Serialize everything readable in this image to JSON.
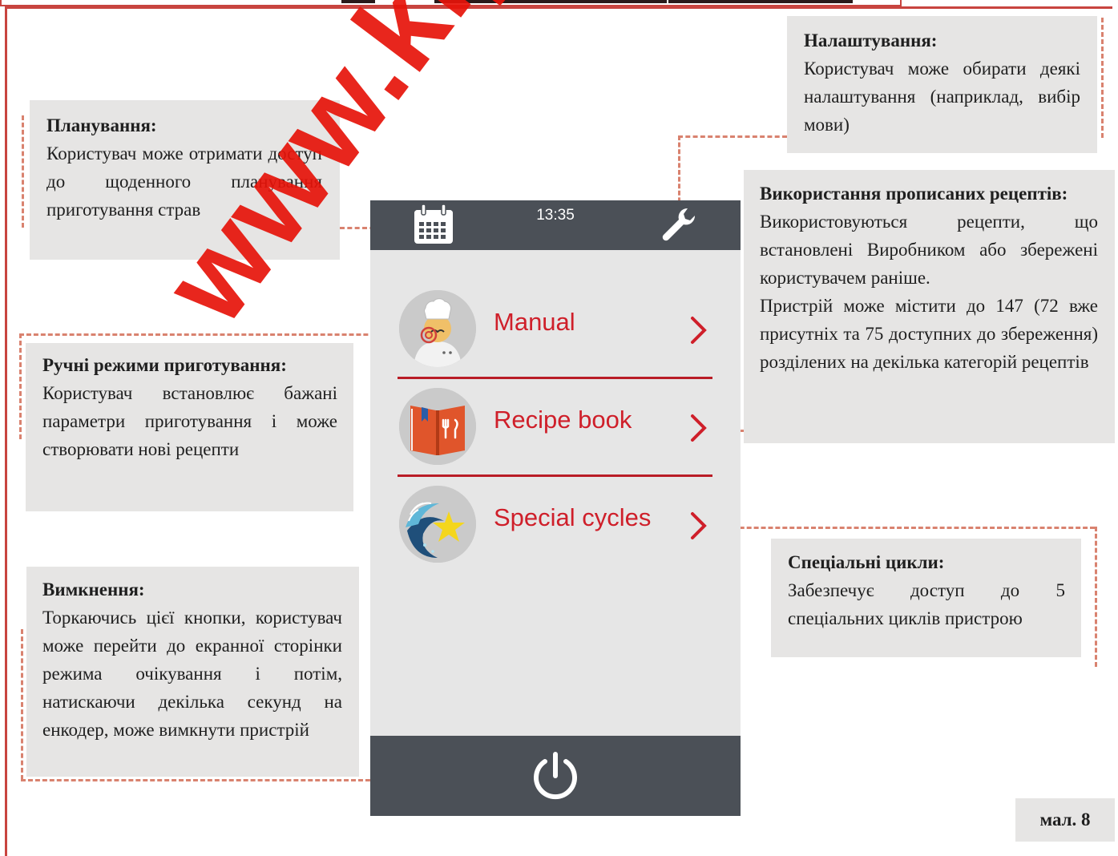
{
  "device": {
    "time": "13:35",
    "menu": [
      {
        "label": "Manual",
        "icon": "chef-icon"
      },
      {
        "label": "Recipe book",
        "icon": "recipe-book-icon"
      },
      {
        "label": "Special cycles",
        "icon": "special-cycles-icon"
      }
    ],
    "accent_color": "#cf1f2a",
    "bar_color": "#4b5057"
  },
  "notes": {
    "planning": {
      "title": "Планування:",
      "body": "Користувач може отримати доступ до щоденного планування приготування страв"
    },
    "settings": {
      "title": "Налаштування:",
      "body": "Користувач може обирати деякі налаштування (наприклад, вибір мови)"
    },
    "recipes": {
      "title": "Використання прописаних рецептів:",
      "body": "Використовуються рецепти, що встановлені Виробником або збережені користувачем раніше.",
      "body2": "Пристрій може містити до 147 (72 вже присутніх та 75 доступних до збереження) розділених на декілька категорій рецептів"
    },
    "manual": {
      "title": "Ручні режими приготування:",
      "body": "Користувач встановлює бажані параметри приготування і може створювати нові рецепти"
    },
    "shutdown": {
      "title": "Вимкнення:",
      "body": "Торкаючись цієї кнопки, користувач може перейти до екранної сторінки режима очікування і потім, натискаючи декілька секунд на енкодер, може вимкнути пристрій"
    },
    "special": {
      "title": "Спеціальні цикли:",
      "body": "Забезпечує доступ до 5 спеціальних циклів пристрою"
    }
  },
  "watermark": "www.kiy",
  "figure_label": "мал. 8"
}
